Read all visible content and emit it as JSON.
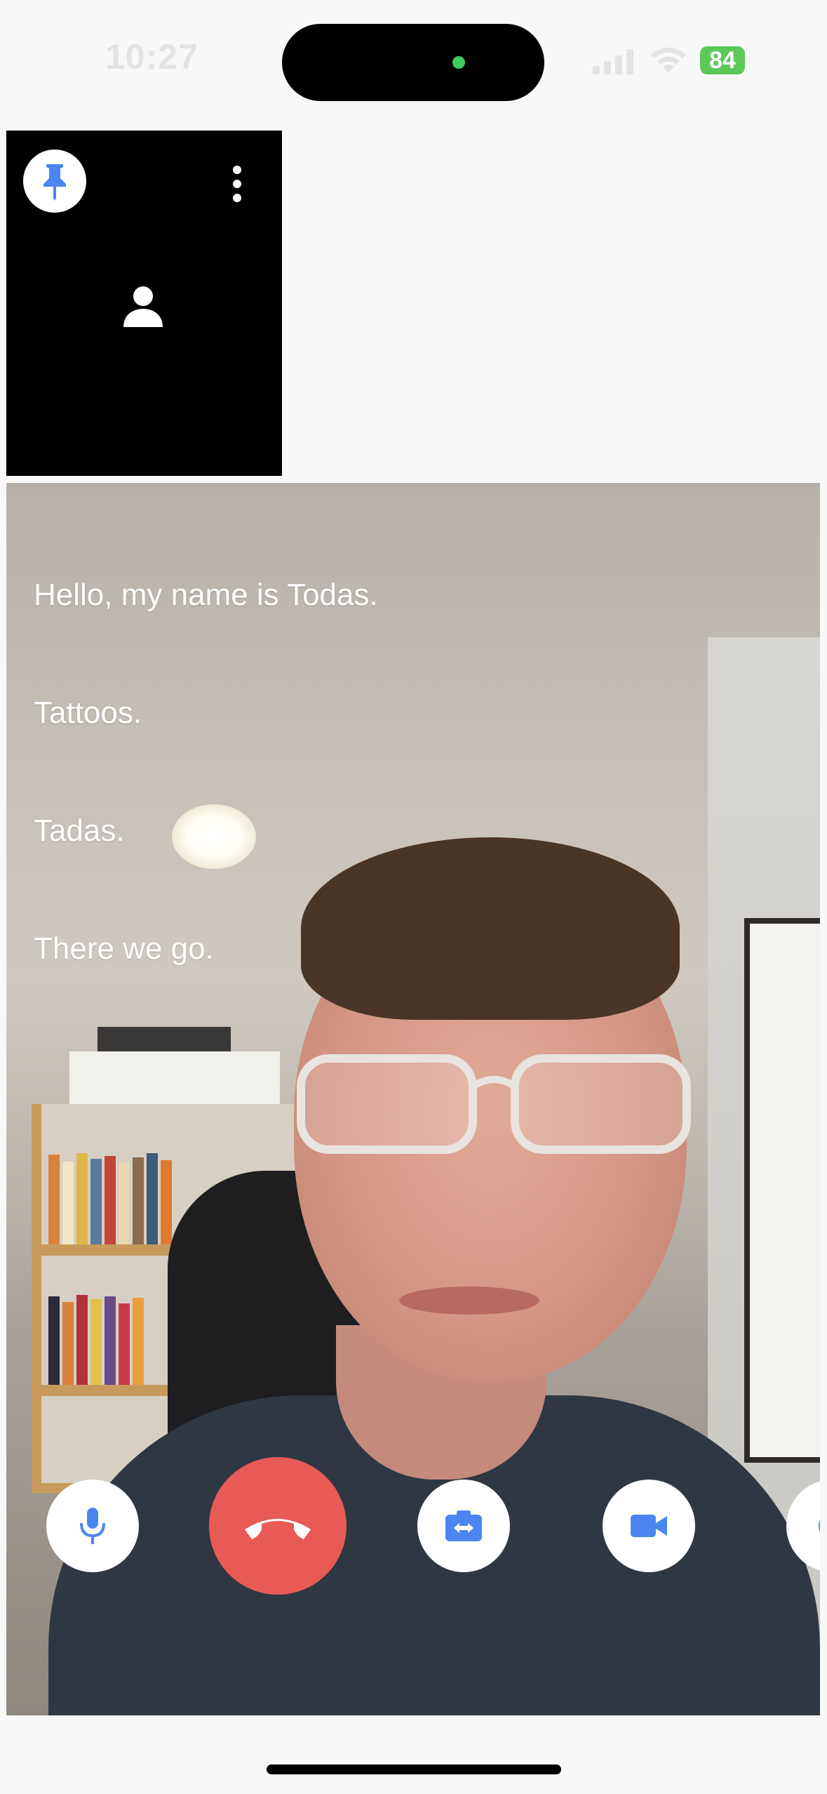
{
  "status_bar": {
    "time": "10:27",
    "battery_percent": "84",
    "battery_color": "#5cc85a"
  },
  "pinned_tile": {
    "pin_icon": "pin-icon",
    "more_icon": "more-vertical-icon",
    "avatar_icon": "person-icon"
  },
  "captions": [
    "Hello, my name is Todas.",
    "Tattoos.",
    "Tadas.",
    "There we go."
  ],
  "controls": {
    "mic_icon": "microphone-icon",
    "end_call_icon": "phone-hangup-icon",
    "switch_camera_icon": "switch-camera-icon",
    "video_icon": "video-camera-icon",
    "accent_color": "#4b86f0",
    "end_call_color": "#e75a55"
  }
}
